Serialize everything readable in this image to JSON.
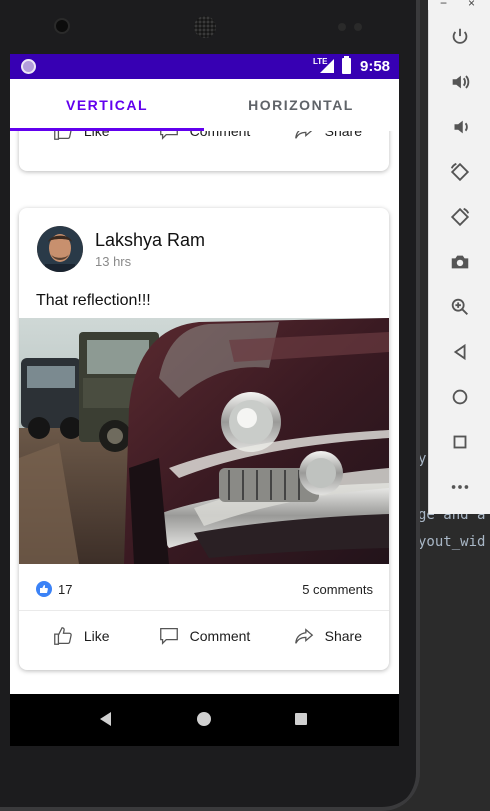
{
  "status_bar": {
    "network": "LTE",
    "time": "9:58"
  },
  "tabs": [
    {
      "label": "VERTICAL",
      "selected": true
    },
    {
      "label": "HORIZONTAL",
      "selected": false
    }
  ],
  "post_actions": {
    "like": "Like",
    "comment": "Comment",
    "share": "Share"
  },
  "post": {
    "author": "Lakshya Ram",
    "time": "13 hrs",
    "caption": "That reflection!!!",
    "likes": "17",
    "comments": "5 comments"
  },
  "ide_lines": [
    "y",
    "ge and a",
    "yout_wid"
  ],
  "emulator_panel": {
    "window_buttons": [
      "−",
      "×"
    ],
    "icons": [
      "power-icon",
      "volume-up-icon",
      "volume-down-icon",
      "rotate-left-icon",
      "rotate-right-icon",
      "camera-icon",
      "zoom-icon",
      "back-icon",
      "home-icon",
      "overview-icon",
      "more-icon"
    ]
  },
  "colors": {
    "accent": "#6200ee",
    "status_bar": "#3700b3",
    "like_blue": "#3b82f6"
  }
}
